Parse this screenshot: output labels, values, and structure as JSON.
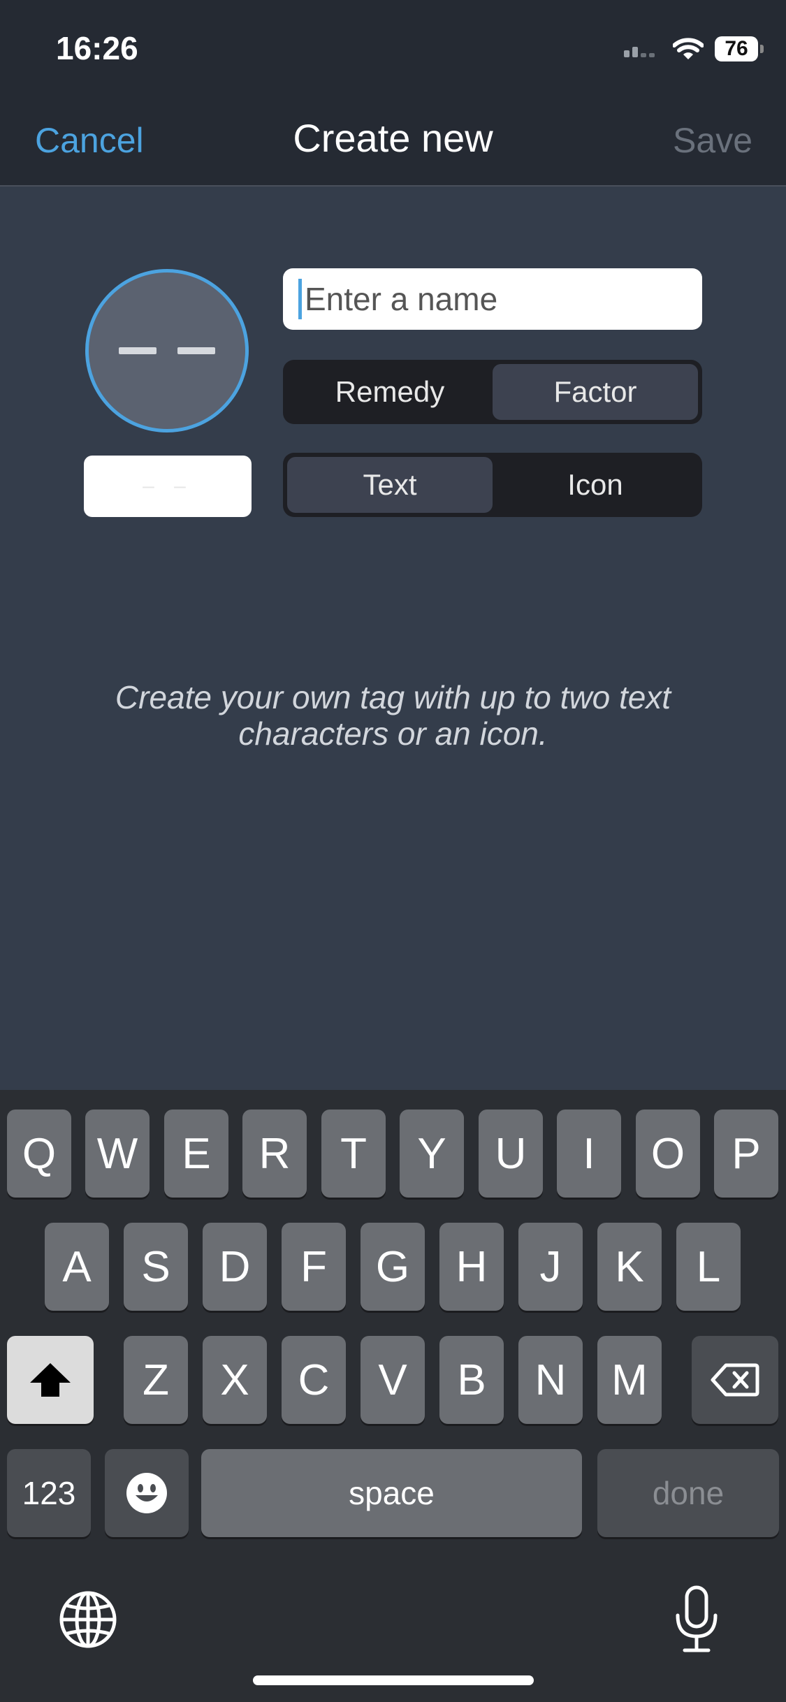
{
  "status": {
    "time": "16:26",
    "battery": "76"
  },
  "nav": {
    "cancel": "Cancel",
    "title": "Create new",
    "save": "Save"
  },
  "form": {
    "name_placeholder": "Enter a name",
    "type_options": [
      "Remedy",
      "Factor"
    ],
    "type_selected": "Factor",
    "mode_options": [
      "Text",
      "Icon"
    ],
    "mode_selected": "Text",
    "hint": "Create your own tag with up to two text characters or an icon."
  },
  "keyboard": {
    "row1": [
      "Q",
      "W",
      "E",
      "R",
      "T",
      "Y",
      "U",
      "I",
      "O",
      "P"
    ],
    "row2": [
      "A",
      "S",
      "D",
      "F",
      "G",
      "H",
      "J",
      "K",
      "L"
    ],
    "row3": [
      "Z",
      "X",
      "C",
      "V",
      "B",
      "N",
      "M"
    ],
    "numbers": "123",
    "space": "space",
    "done": "done"
  },
  "colors": {
    "accent": "#4ca3e0",
    "background": "#343d4b",
    "nav_bg": "#252a33"
  }
}
